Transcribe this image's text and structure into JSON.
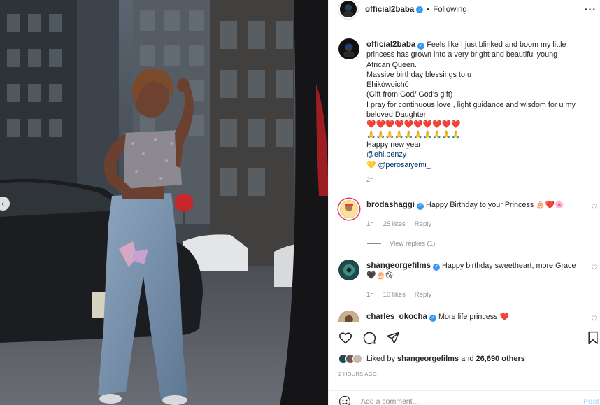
{
  "post": {
    "author": "official2baba",
    "follow_status": "Following",
    "caption_lines": [
      "Feels like I just blinked and boom my little",
      "princess has grown into a very bright and beautiful young",
      "African Queen.",
      "Massive birthday blessings to u",
      "Ehikòwoichó",
      "(Gift from God/ God’s gift)",
      "I pray for continuous love , light guidance and wisdom for u my",
      "beloved Daughter"
    ],
    "emoji_hearts": "❤️❤️❤️❤️❤️❤️❤️❤️❤️❤️",
    "emoji_pray": "🙏🙏🙏🙏🙏🙏🙏🙏🙏🙏",
    "closing": "Happy new year",
    "mention_1": "@ehi.benzy",
    "mention_2_emoji": "💛",
    "mention_2": "@perosaiyemi_",
    "time": "2h"
  },
  "comments": [
    {
      "user": "brodashaggi",
      "text": "Happy Birthday to your Princess 🎂❤️🌸",
      "time": "1h",
      "likes": "25 likes",
      "reply": "Reply",
      "view_replies": "View replies (1)"
    },
    {
      "user": "shangeorgefilms",
      "text": "Happy birthday sweetheart, more Grace",
      "text2": "🖤🎂😘",
      "time": "1h",
      "likes": "10 likes",
      "reply": "Reply"
    },
    {
      "user": "charles_okocha",
      "text": "More life princess ❤️"
    }
  ],
  "footer": {
    "liked_by_prefix": "Liked by ",
    "liked_by_user": "shangeorgefilms",
    "liked_by_suffix": " and ",
    "liked_by_others": "26,690 others",
    "timestamp": "2 HOURS AGO",
    "comment_placeholder": "Add a comment...",
    "post_label": "Post"
  },
  "colors": {
    "verified": "#3897f0",
    "link": "#00376b",
    "muted": "#8e8e8e",
    "post_button": "#b2dffc"
  },
  "icons": [
    "heart-icon",
    "comment-icon",
    "share-icon",
    "bookmark-icon",
    "smile-icon",
    "more-icon",
    "chevron-left-icon",
    "verified-icon"
  ]
}
